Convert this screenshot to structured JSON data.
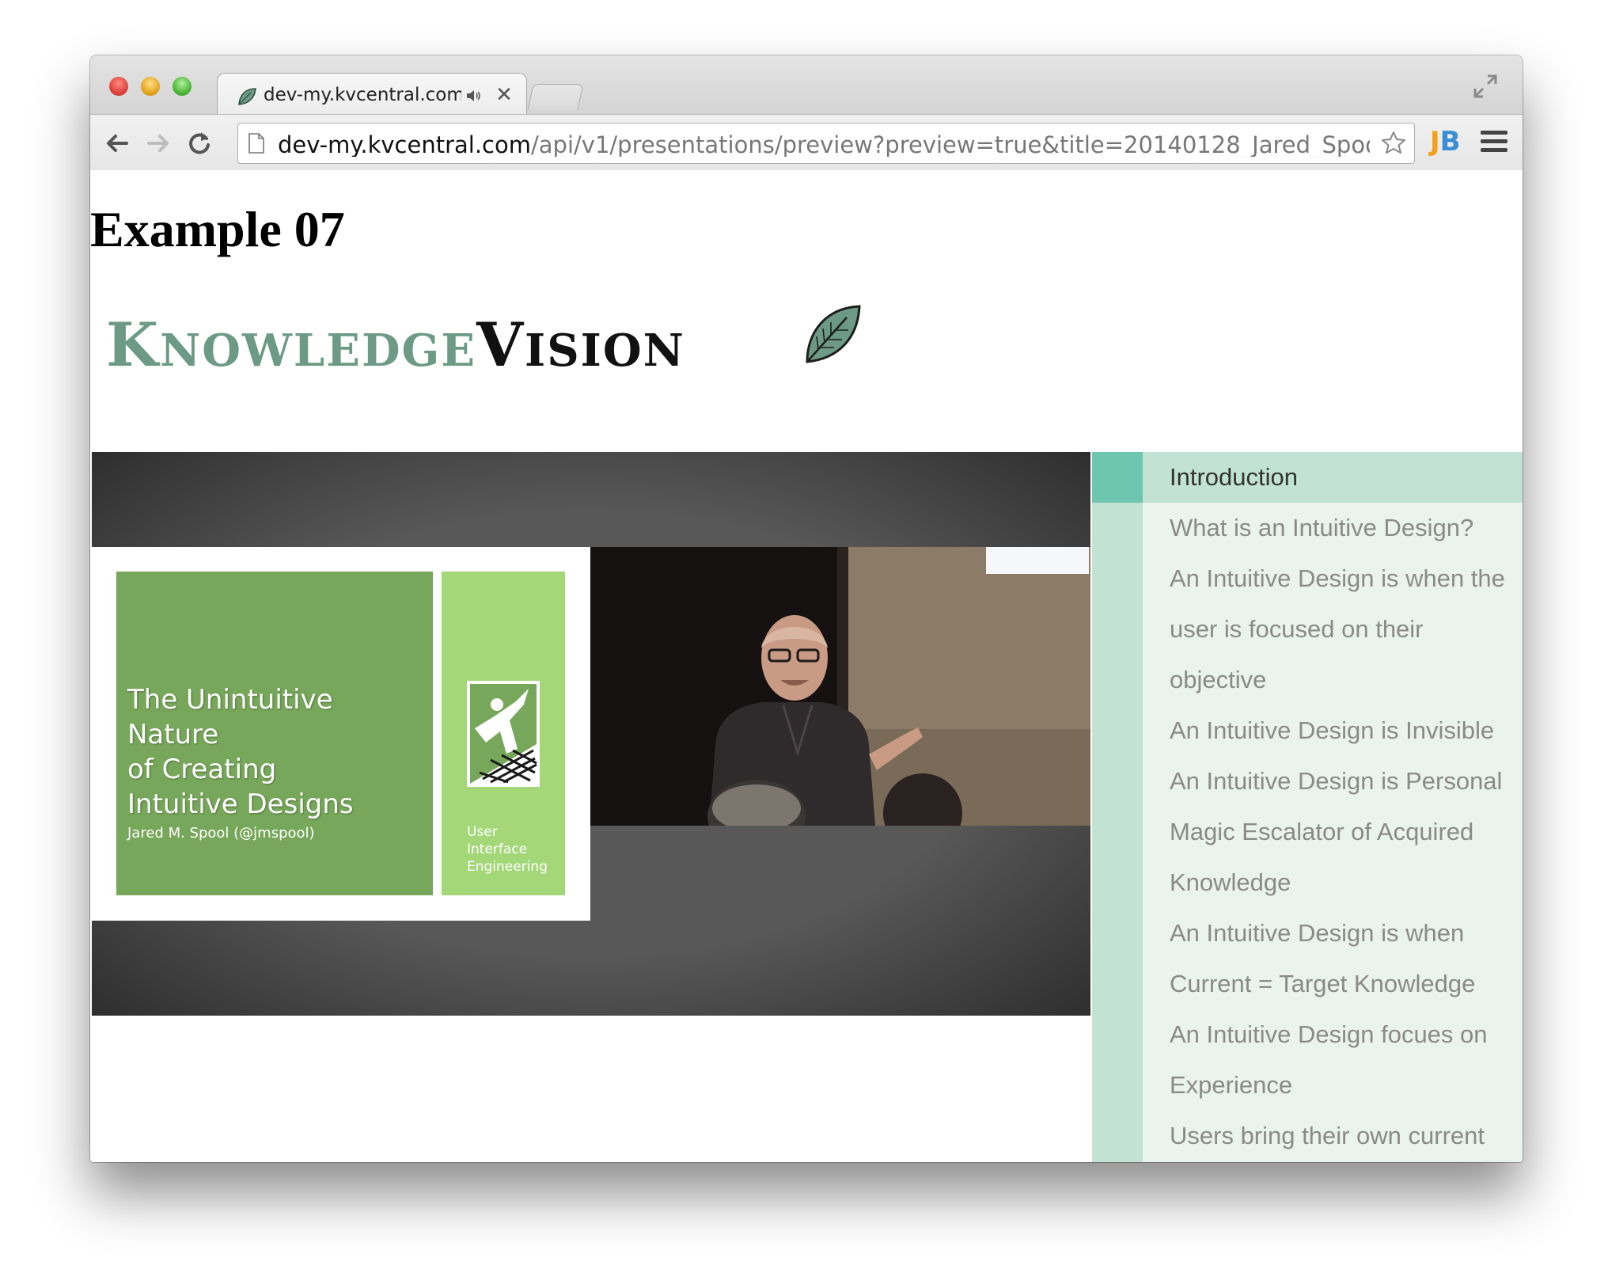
{
  "browser": {
    "tab": {
      "title": "dev-my.kvcentral.com/",
      "close_label": "✕",
      "audio_icon": "speaker-icon"
    },
    "url": {
      "host": "dev-my.kvcentral.com",
      "path": "/api/v1/presentations/preview?preview=true&title=20140128_Jared_Spool&..."
    },
    "extension_label_j": "J",
    "extension_label_b": "B"
  },
  "page": {
    "title": "Example 07",
    "logo": {
      "knowledge_initial": "K",
      "knowledge_rest": "NOWLEDGE",
      "vision_initial": "V",
      "vision_rest": "ISION"
    },
    "slide": {
      "title": "The Unintuitive Nature\nof Creating\nIntuitive Designs",
      "author": "Jared M. Spool (@jmspool)",
      "side_text": "User\nInterface\nEngineering"
    },
    "chapters": [
      {
        "label": "Introduction",
        "active": true
      },
      {
        "label": "What is an Intuitive Design?",
        "active": false
      },
      {
        "label": "An Intuitive Design is when the user is focused on their objective",
        "active": false
      },
      {
        "label": "An Intuitive Design is Invisible",
        "active": false
      },
      {
        "label": "An Intuitive Design is Personal",
        "active": false
      },
      {
        "label": "Magic Escalator of Acquired Knowledge",
        "active": false
      },
      {
        "label": "An Intuitive Design is when Current = Target Knowledge",
        "active": false
      },
      {
        "label": "An Intuitive Design focues on Experience",
        "active": false
      },
      {
        "label": "Users bring their own current knowledge",
        "active": false
      }
    ]
  },
  "colors": {
    "accent_green": "#6fc6b0",
    "sidebar_bg": "#ebf3ee",
    "sidebar_active": "#c2e2d4",
    "slide_green": "#77a75a",
    "slide_light_green": "#a3d778"
  }
}
